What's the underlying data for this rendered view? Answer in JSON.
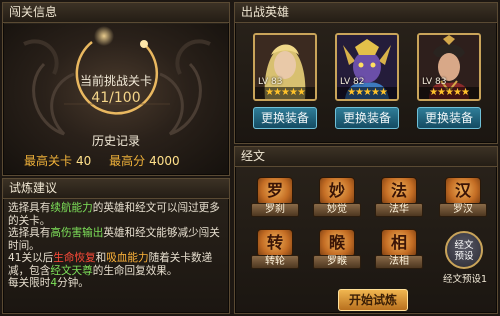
{
  "level_panel": {
    "title": "闯关信息",
    "current_label": "当前挑战关卡",
    "current_value": "41/100",
    "history_label": "历史记录",
    "max_level_label": "最高关卡",
    "max_level_value": "40",
    "max_score_label": "最高分",
    "max_score_value": "4000"
  },
  "tips_panel": {
    "title": "试炼建议",
    "lines": [
      [
        {
          "t": "选择具有",
          "c": ""
        },
        {
          "t": "续航能力",
          "c": "g"
        },
        {
          "t": "的英雄和经文可以闯过更多的关卡。",
          "c": ""
        }
      ],
      [
        {
          "t": "选择具有",
          "c": ""
        },
        {
          "t": "高伤害输出",
          "c": "g"
        },
        {
          "t": "英雄和经文能够减少闯关时间。",
          "c": ""
        }
      ],
      [
        {
          "t": "41关以后",
          "c": ""
        },
        {
          "t": "生命恢复",
          "c": "r"
        },
        {
          "t": "和",
          "c": ""
        },
        {
          "t": "吸血能力",
          "c": "o"
        },
        {
          "t": "随着关卡数递减，包含",
          "c": ""
        },
        {
          "t": "经文天尊",
          "c": "g"
        },
        {
          "t": "的生命回复效果。",
          "c": ""
        }
      ],
      [
        {
          "t": "每关限时",
          "c": ""
        },
        {
          "t": "4",
          "c": "g"
        },
        {
          "t": "分钟。",
          "c": ""
        }
      ]
    ]
  },
  "heroes_panel": {
    "title": "出战英雄",
    "heroes": [
      {
        "level": "LV 83",
        "stars": "★★★★★",
        "equip_label": "更换装备",
        "color": "#c8a58a"
      },
      {
        "level": "LV 82",
        "stars": "★★★★★",
        "equip_label": "更换装备",
        "color": "#6b4fa8"
      },
      {
        "level": "LV 83",
        "stars": "★★★★★",
        "equip_label": "更换装备",
        "color": "#8a5a4a"
      }
    ]
  },
  "scripture_panel": {
    "title": "经文",
    "items": [
      {
        "name": "罗刹",
        "glyph": "罗"
      },
      {
        "name": "妙觉",
        "glyph": "妙"
      },
      {
        "name": "法华",
        "glyph": "法"
      },
      {
        "name": "罗汉",
        "glyph": "汉"
      },
      {
        "name": "转轮",
        "glyph": "转"
      },
      {
        "name": "罗睺",
        "glyph": "睺"
      },
      {
        "name": "法相",
        "glyph": "相"
      }
    ],
    "preset_button": "经文\n预设",
    "preset_label": "经文预设1",
    "start_button": "开始试炼"
  }
}
